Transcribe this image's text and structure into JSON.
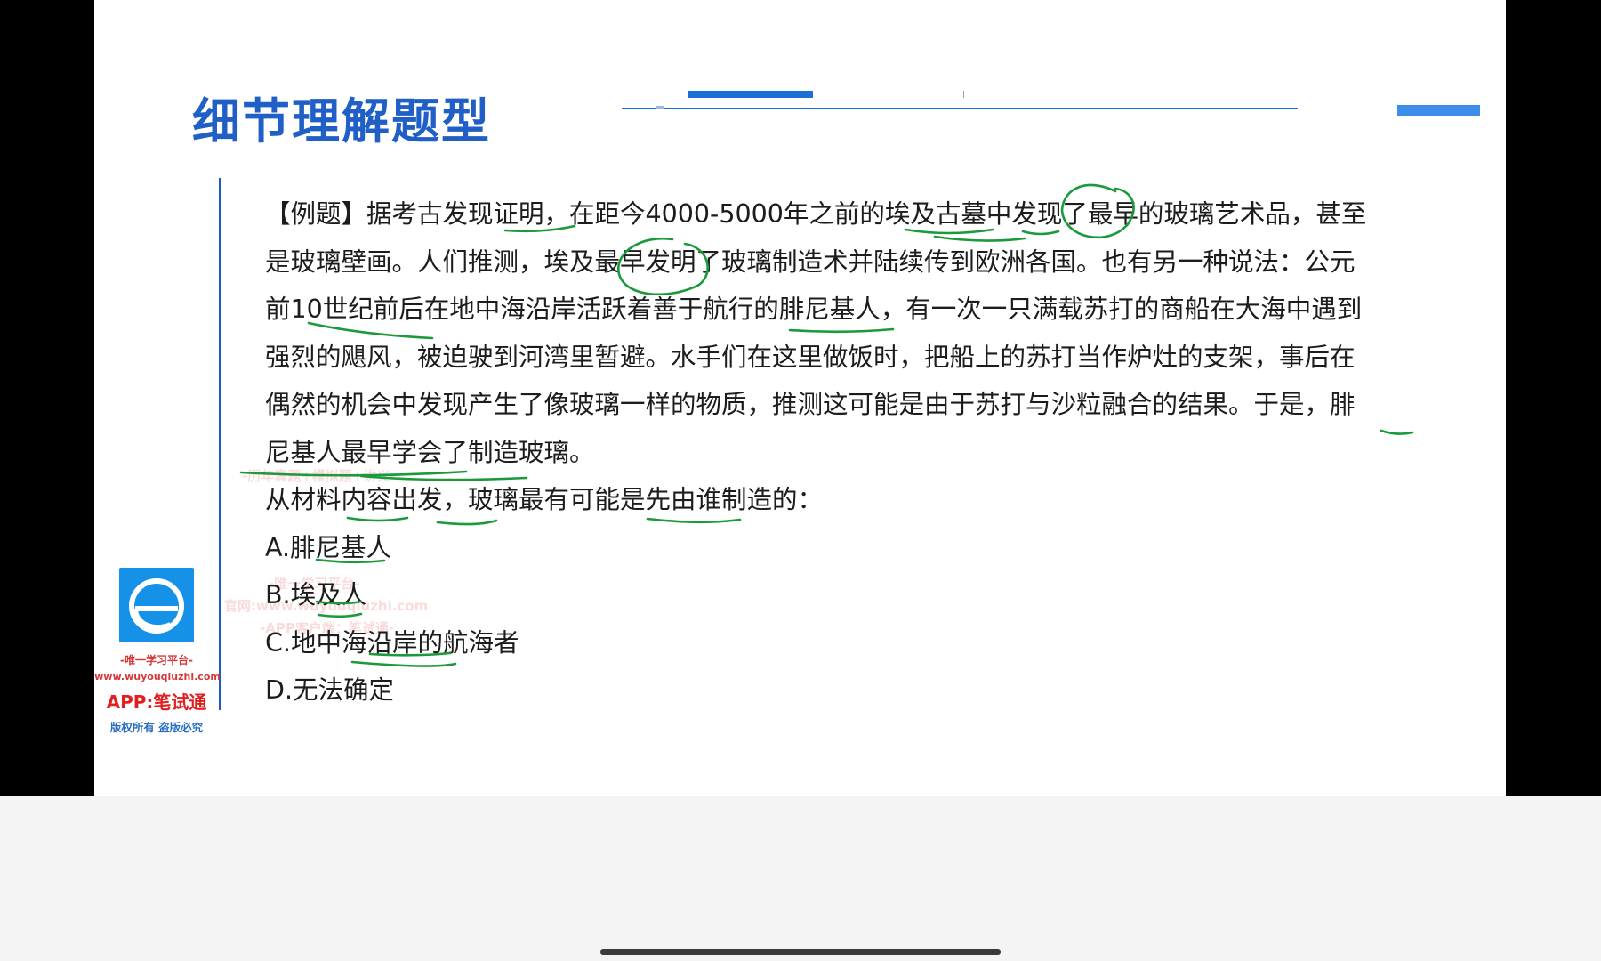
{
  "slide": {
    "title": "细节理解题型",
    "passage_lines": [
      "【例题】据考古发现证明，在距今4000-5000年之前的埃及古墓中发现了最早的玻璃艺术品，甚至",
      "是玻璃壁画。人们推测，埃及最早发明了玻璃制造术并陆续传到欧洲各国。也有另一种说法：公元",
      "前10世纪前后在地中海沿岸活跃着善于航行的腓尼基人，有一次一只满载苏打的商船在大海中遇到",
      "强烈的飓风，被迫驶到河湾里暂避。水手们在这里做饭时，把船上的苏打当作炉灶的支架，事后在",
      "偶然的机会中发现产生了像玻璃一样的物质，推测这可能是由于苏打与沙粒融合的结果。于是，腓",
      "尼基人最早学会了制造玻璃。"
    ],
    "question": "从材料内容出发，玻璃最有可能是先由谁制造的：",
    "options": [
      "A.腓尼基人",
      "B.埃及人",
      "C.地中海沿岸的航海者",
      "D.无法确定"
    ]
  },
  "branding": {
    "logo_icon": "e-logo-icon",
    "tagline": "-唯一学习平台-",
    "url": "www.wuyouqiuzhi.com",
    "app": "APP:笔试通",
    "copyright": "版权所有 盗版必究"
  },
  "watermark_lines": [
    "-历年真题+模拟题+讲义-",
    "-唯一学习平台-",
    "官网:www.wuyouqiuzhi.com",
    "-APP客户端：笔试通-"
  ],
  "colors": {
    "title_blue": "#1f5fc6",
    "accent_blue": "#1a6fd8",
    "annotation_green": "#1a9a3a",
    "brand_red": "#e02020"
  }
}
